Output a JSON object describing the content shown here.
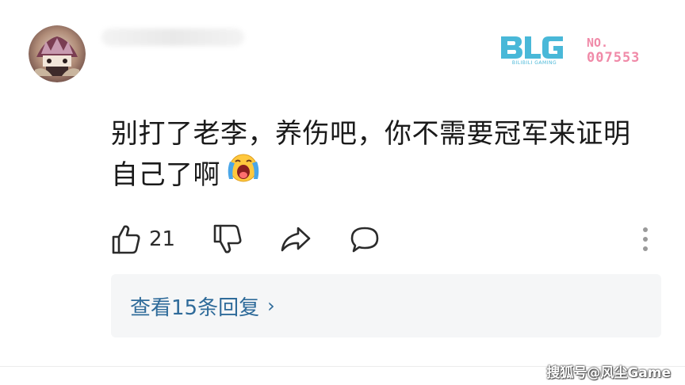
{
  "comment": {
    "line1": "别打了老李，养伤吧，你不需要冠军来证明",
    "line2": "自己了啊",
    "emoji_icon": "crying-face-icon"
  },
  "badge": {
    "logo_text": "BLG",
    "logo_subtext": "BILIBILI GAMING",
    "no_label": "NO.",
    "number": "007553",
    "color": "#f08aa8",
    "logo_color": "#49b8d8"
  },
  "actions": {
    "like_count": "21",
    "like_icon": "thumbs-up-icon",
    "dislike_icon": "thumbs-down-icon",
    "share_icon": "share-arrow-icon",
    "comment_icon": "comment-bubble-icon",
    "more_icon": "more-vertical-icon"
  },
  "replies": {
    "label": "查看15条回复",
    "chevron": "›",
    "color": "#2f6b9a"
  },
  "watermark": "搜狐号@风尘Game"
}
